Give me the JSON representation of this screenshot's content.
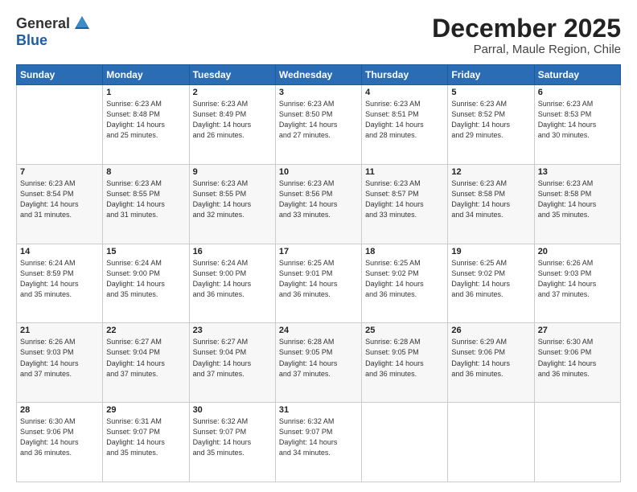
{
  "header": {
    "logo_general": "General",
    "logo_blue": "Blue",
    "title": "December 2025",
    "subtitle": "Parral, Maule Region, Chile"
  },
  "calendar": {
    "days_of_week": [
      "Sunday",
      "Monday",
      "Tuesday",
      "Wednesday",
      "Thursday",
      "Friday",
      "Saturday"
    ],
    "weeks": [
      [
        {
          "day": "",
          "info": ""
        },
        {
          "day": "1",
          "info": "Sunrise: 6:23 AM\nSunset: 8:48 PM\nDaylight: 14 hours\nand 25 minutes."
        },
        {
          "day": "2",
          "info": "Sunrise: 6:23 AM\nSunset: 8:49 PM\nDaylight: 14 hours\nand 26 minutes."
        },
        {
          "day": "3",
          "info": "Sunrise: 6:23 AM\nSunset: 8:50 PM\nDaylight: 14 hours\nand 27 minutes."
        },
        {
          "day": "4",
          "info": "Sunrise: 6:23 AM\nSunset: 8:51 PM\nDaylight: 14 hours\nand 28 minutes."
        },
        {
          "day": "5",
          "info": "Sunrise: 6:23 AM\nSunset: 8:52 PM\nDaylight: 14 hours\nand 29 minutes."
        },
        {
          "day": "6",
          "info": "Sunrise: 6:23 AM\nSunset: 8:53 PM\nDaylight: 14 hours\nand 30 minutes."
        }
      ],
      [
        {
          "day": "7",
          "info": "Sunrise: 6:23 AM\nSunset: 8:54 PM\nDaylight: 14 hours\nand 31 minutes."
        },
        {
          "day": "8",
          "info": "Sunrise: 6:23 AM\nSunset: 8:55 PM\nDaylight: 14 hours\nand 31 minutes."
        },
        {
          "day": "9",
          "info": "Sunrise: 6:23 AM\nSunset: 8:55 PM\nDaylight: 14 hours\nand 32 minutes."
        },
        {
          "day": "10",
          "info": "Sunrise: 6:23 AM\nSunset: 8:56 PM\nDaylight: 14 hours\nand 33 minutes."
        },
        {
          "day": "11",
          "info": "Sunrise: 6:23 AM\nSunset: 8:57 PM\nDaylight: 14 hours\nand 33 minutes."
        },
        {
          "day": "12",
          "info": "Sunrise: 6:23 AM\nSunset: 8:58 PM\nDaylight: 14 hours\nand 34 minutes."
        },
        {
          "day": "13",
          "info": "Sunrise: 6:23 AM\nSunset: 8:58 PM\nDaylight: 14 hours\nand 35 minutes."
        }
      ],
      [
        {
          "day": "14",
          "info": "Sunrise: 6:24 AM\nSunset: 8:59 PM\nDaylight: 14 hours\nand 35 minutes."
        },
        {
          "day": "15",
          "info": "Sunrise: 6:24 AM\nSunset: 9:00 PM\nDaylight: 14 hours\nand 35 minutes."
        },
        {
          "day": "16",
          "info": "Sunrise: 6:24 AM\nSunset: 9:00 PM\nDaylight: 14 hours\nand 36 minutes."
        },
        {
          "day": "17",
          "info": "Sunrise: 6:25 AM\nSunset: 9:01 PM\nDaylight: 14 hours\nand 36 minutes."
        },
        {
          "day": "18",
          "info": "Sunrise: 6:25 AM\nSunset: 9:02 PM\nDaylight: 14 hours\nand 36 minutes."
        },
        {
          "day": "19",
          "info": "Sunrise: 6:25 AM\nSunset: 9:02 PM\nDaylight: 14 hours\nand 36 minutes."
        },
        {
          "day": "20",
          "info": "Sunrise: 6:26 AM\nSunset: 9:03 PM\nDaylight: 14 hours\nand 37 minutes."
        }
      ],
      [
        {
          "day": "21",
          "info": "Sunrise: 6:26 AM\nSunset: 9:03 PM\nDaylight: 14 hours\nand 37 minutes."
        },
        {
          "day": "22",
          "info": "Sunrise: 6:27 AM\nSunset: 9:04 PM\nDaylight: 14 hours\nand 37 minutes."
        },
        {
          "day": "23",
          "info": "Sunrise: 6:27 AM\nSunset: 9:04 PM\nDaylight: 14 hours\nand 37 minutes."
        },
        {
          "day": "24",
          "info": "Sunrise: 6:28 AM\nSunset: 9:05 PM\nDaylight: 14 hours\nand 37 minutes."
        },
        {
          "day": "25",
          "info": "Sunrise: 6:28 AM\nSunset: 9:05 PM\nDaylight: 14 hours\nand 36 minutes."
        },
        {
          "day": "26",
          "info": "Sunrise: 6:29 AM\nSunset: 9:06 PM\nDaylight: 14 hours\nand 36 minutes."
        },
        {
          "day": "27",
          "info": "Sunrise: 6:30 AM\nSunset: 9:06 PM\nDaylight: 14 hours\nand 36 minutes."
        }
      ],
      [
        {
          "day": "28",
          "info": "Sunrise: 6:30 AM\nSunset: 9:06 PM\nDaylight: 14 hours\nand 36 minutes."
        },
        {
          "day": "29",
          "info": "Sunrise: 6:31 AM\nSunset: 9:07 PM\nDaylight: 14 hours\nand 35 minutes."
        },
        {
          "day": "30",
          "info": "Sunrise: 6:32 AM\nSunset: 9:07 PM\nDaylight: 14 hours\nand 35 minutes."
        },
        {
          "day": "31",
          "info": "Sunrise: 6:32 AM\nSunset: 9:07 PM\nDaylight: 14 hours\nand 34 minutes."
        },
        {
          "day": "",
          "info": ""
        },
        {
          "day": "",
          "info": ""
        },
        {
          "day": "",
          "info": ""
        }
      ]
    ]
  }
}
